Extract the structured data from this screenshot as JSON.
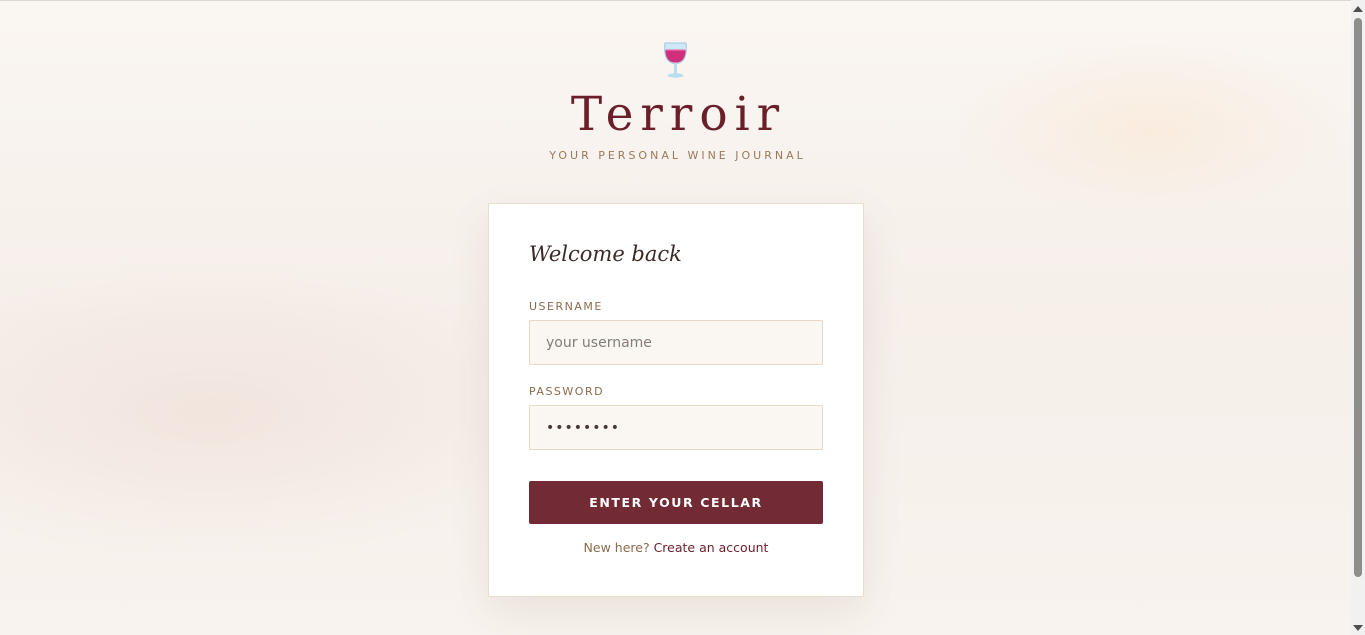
{
  "brand": {
    "name": "Terroir",
    "tagline": "YOUR PERSONAL WINE JOURNAL",
    "icon": "wine-glass-icon"
  },
  "login": {
    "heading": "Welcome back",
    "username_label": "USERNAME",
    "username_placeholder": "your username",
    "username_value": "",
    "password_label": "PASSWORD",
    "password_value": "********",
    "submit_label": "ENTER YOUR CELLAR",
    "signup_prompt": "New here?",
    "signup_link": "Create an account"
  },
  "colors": {
    "accent": "#722b34",
    "brand_text": "#6b1f2b",
    "label_text": "#8b6a4e",
    "field_bg": "#faf6f1"
  }
}
